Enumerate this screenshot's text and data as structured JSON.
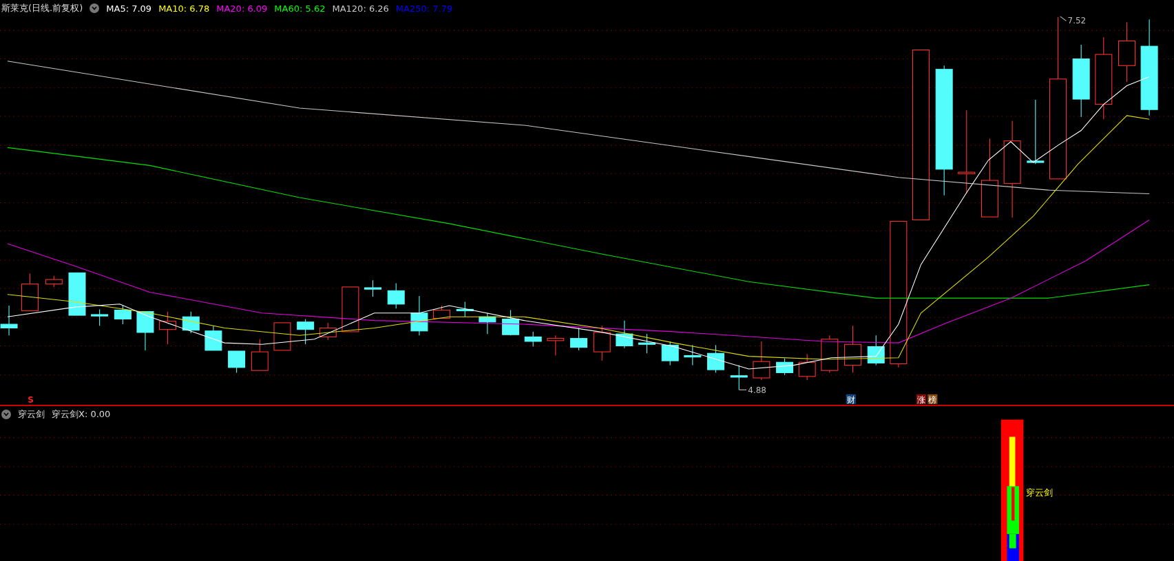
{
  "title": {
    "name": "斯莱克(日线.前复权)",
    "indicators": [
      {
        "label": "MA5: 7.09",
        "color": "#ffffff"
      },
      {
        "label": "MA10: 6.78",
        "color": "#ffff00"
      },
      {
        "label": "MA20: 6.09",
        "color": "#ff00ff"
      },
      {
        "label": "MA60: 5.62",
        "color": "#00ff00"
      },
      {
        "label": "MA120: 6.26",
        "color": "#c8c8c8"
      },
      {
        "label": "MA250: 7.79",
        "color": "#0000ff"
      }
    ]
  },
  "price_chart": {
    "high_label": "7.52",
    "low_label": "4.88",
    "signal_mark": "S",
    "event_tags": [
      {
        "text": "财",
        "color": "#14467e"
      },
      {
        "text": "涨",
        "color": "#8a0a0a"
      },
      {
        "text": "榜",
        "color": "#8a4a10"
      }
    ]
  },
  "indicator_panel": {
    "name": "穿云剑",
    "value": "穿云剑X: 0.00",
    "signal_label": "穿云剑"
  }
}
